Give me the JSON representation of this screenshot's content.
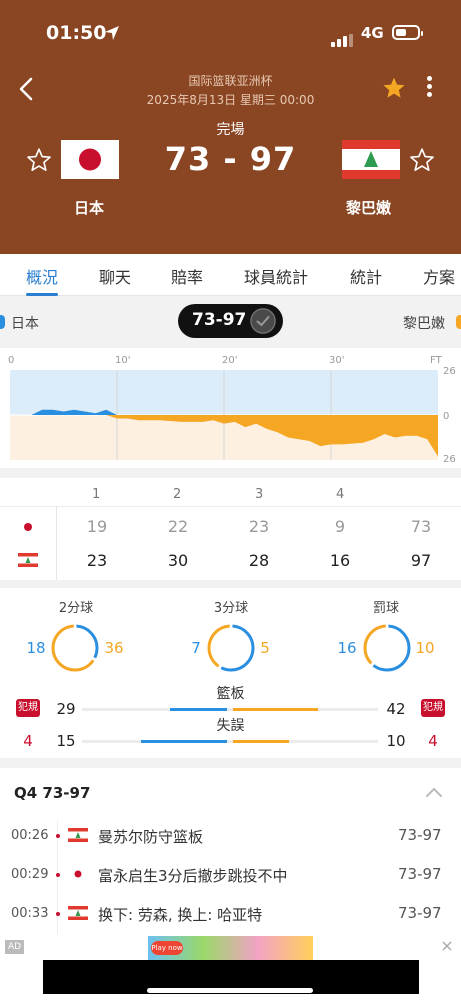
{
  "status_bar": {
    "time": "01:50",
    "network": "4G"
  },
  "header": {
    "league": "国际篮联亚洲杯",
    "date": "2025年8月13日 星期三 00:00",
    "status": "完場",
    "score": "73 - 97",
    "home_team": "日本",
    "away_team": "黎巴嫩"
  },
  "tabs": [
    "概況",
    "聊天",
    "賠率",
    "球員統計",
    "統計",
    "方案"
  ],
  "strip": {
    "home": "日本",
    "away": "黎巴嫩",
    "score": "73-97"
  },
  "chart_data": {
    "type": "area",
    "x_ticks": [
      "0",
      "10'",
      "20'",
      "30'",
      "FT"
    ],
    "y_ticks": [
      "26",
      "0",
      "26"
    ],
    "home_color": "#2a8fe0",
    "away_color": "#f5a623",
    "points": [
      [
        0,
        0
      ],
      [
        2,
        0
      ],
      [
        3,
        3
      ],
      [
        4,
        3
      ],
      [
        5,
        2
      ],
      [
        6,
        3
      ],
      [
        7,
        2
      ],
      [
        8,
        1
      ],
      [
        9,
        3
      ],
      [
        10,
        -2
      ],
      [
        11,
        -2
      ],
      [
        12,
        -3
      ],
      [
        14,
        -3
      ],
      [
        16,
        -4
      ],
      [
        18,
        -4
      ],
      [
        19,
        -3
      ],
      [
        20,
        -5
      ],
      [
        21,
        -4
      ],
      [
        22,
        -7
      ],
      [
        23,
        -5
      ],
      [
        24,
        -8
      ],
      [
        25,
        -10
      ],
      [
        26,
        -13
      ],
      [
        28,
        -15
      ],
      [
        29,
        -18
      ],
      [
        30,
        -17
      ],
      [
        31,
        -17
      ],
      [
        33,
        -16
      ],
      [
        34,
        -14
      ],
      [
        35,
        -11
      ],
      [
        36,
        -13
      ],
      [
        37,
        -12
      ],
      [
        38,
        -12
      ],
      [
        39,
        -14
      ],
      [
        40,
        -24
      ]
    ]
  },
  "quarters": {
    "headers": [
      "1",
      "2",
      "3",
      "4",
      ""
    ],
    "home": [
      "19",
      "22",
      "23",
      "9",
      "73"
    ],
    "away": [
      "23",
      "30",
      "28",
      "16",
      "97"
    ]
  },
  "shooting": [
    {
      "label": "2分球",
      "home": "18",
      "away": "36",
      "home_frac": 0.333
    },
    {
      "label": "3分球",
      "home": "7",
      "away": "5",
      "home_frac": 0.583
    },
    {
      "label": "罰球",
      "home": "16",
      "away": "10",
      "home_frac": 0.615
    }
  ],
  "rebounds": {
    "label": "籃板",
    "home": "29",
    "away": "42",
    "home_frac": 0.408
  },
  "turnovers": {
    "label": "失誤",
    "home": "15",
    "away": "10",
    "home_frac": 0.6
  },
  "fouls": {
    "badge": "犯規",
    "home": "4",
    "away": "4"
  },
  "pbp": {
    "title": "Q4  73-97",
    "events": [
      {
        "time": "00:26",
        "team": "away",
        "text": "曼苏尔防守篮板",
        "score": "73-97"
      },
      {
        "time": "00:29",
        "team": "home",
        "text": "富永启生3分后撤步跳投不中",
        "score": "73-97"
      },
      {
        "time": "00:33",
        "team": "away",
        "text": "换下: 劳森, 换上: 哈亚特",
        "score": "73-97"
      }
    ]
  },
  "ad": {
    "tag": "AD",
    "play": "Play now"
  }
}
